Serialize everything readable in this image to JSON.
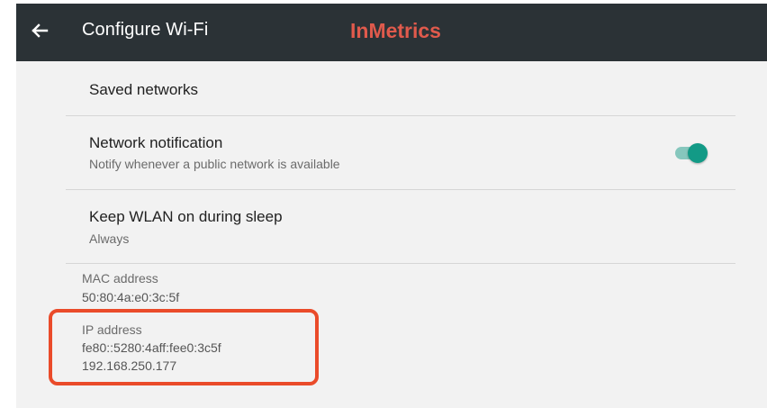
{
  "toolbar": {
    "title": "Configure Wi-Fi",
    "brand": "InMetrics",
    "back_icon": "arrow-back-icon",
    "background_color": "#2b3236",
    "brand_color": "#e05a4c"
  },
  "items": {
    "saved_networks": {
      "title": "Saved networks"
    },
    "network_notification": {
      "title": "Network notification",
      "subtitle": "Notify whenever a public network is available",
      "toggle_on": true,
      "toggle_color": "#129a86"
    },
    "keep_wlan": {
      "title": "Keep WLAN on during sleep",
      "subtitle": "Always"
    }
  },
  "info": {
    "mac_label": "MAC address",
    "mac_value": "50:80:4a:e0:3c:5f",
    "ip_label": "IP address",
    "ip_v6": "fe80::5280:4aff:fee0:3c5f",
    "ip_v4": "192.168.250.177"
  },
  "annotation": {
    "highlight_color": "#ea4b2a"
  }
}
